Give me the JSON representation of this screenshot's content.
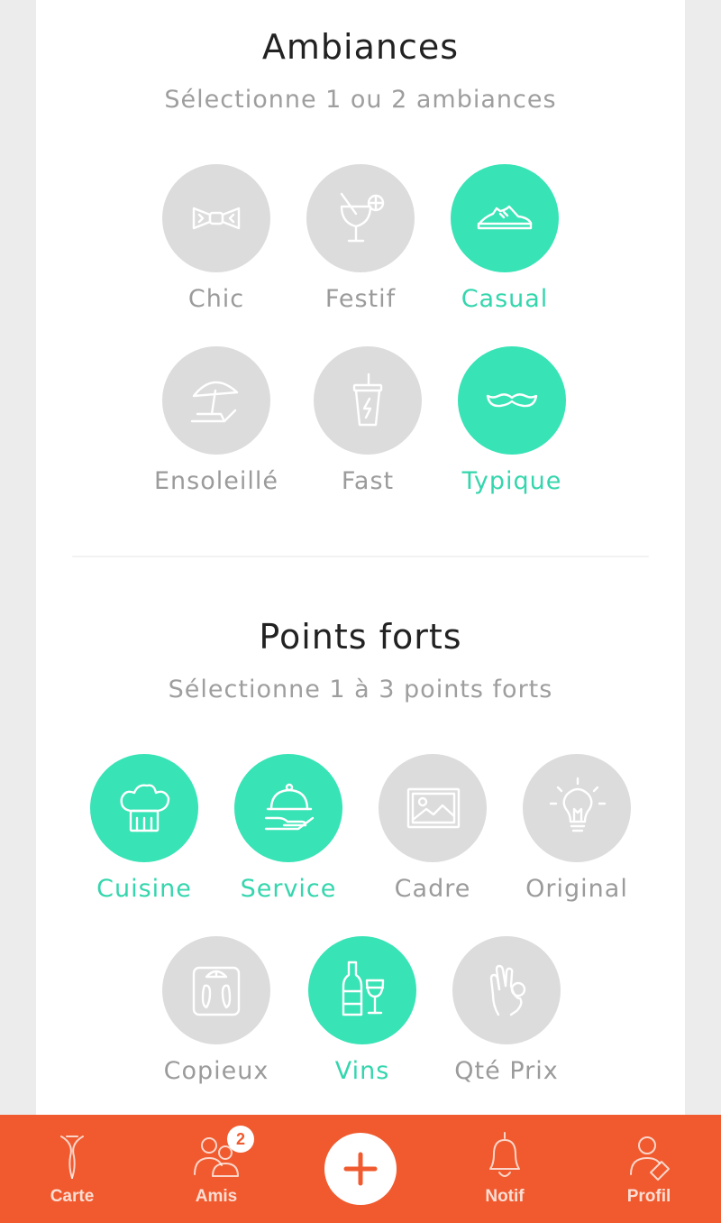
{
  "ambiances": {
    "title": "Ambiances",
    "subtitle": "Sélectionne 1 ou 2 ambiances",
    "options": [
      {
        "label": "Chic",
        "icon": "bow-tie-icon",
        "selected": false
      },
      {
        "label": "Festif",
        "icon": "cocktail-icon",
        "selected": false
      },
      {
        "label": "Casual",
        "icon": "sneaker-icon",
        "selected": true
      },
      {
        "label": "Ensoleillé",
        "icon": "beach-umbrella-icon",
        "selected": false
      },
      {
        "label": "Fast",
        "icon": "takeaway-cup-icon",
        "selected": false
      },
      {
        "label": "Typique",
        "icon": "mustache-icon",
        "selected": true
      }
    ]
  },
  "points_forts": {
    "title": "Points forts",
    "subtitle": "Sélectionne 1 à 3 points forts",
    "options": [
      {
        "label": "Cuisine",
        "icon": "chef-hat-icon",
        "selected": true
      },
      {
        "label": "Service",
        "icon": "cloche-icon",
        "selected": true
      },
      {
        "label": "Cadre",
        "icon": "picture-icon",
        "selected": false
      },
      {
        "label": "Original",
        "icon": "lightbulb-icon",
        "selected": false
      },
      {
        "label": "Copieux",
        "icon": "scale-icon",
        "selected": false
      },
      {
        "label": "Vins",
        "icon": "wine-icon",
        "selected": true
      },
      {
        "label": "Qté Prix",
        "icon": "ok-hand-icon",
        "selected": false
      }
    ]
  },
  "nav": {
    "accent_color": "#f05a2e",
    "items": [
      {
        "label": "Carte",
        "icon": "pin-icon"
      },
      {
        "label": "Amis",
        "icon": "friends-icon",
        "badge": "2"
      },
      {
        "label": "",
        "icon": "plus-icon"
      },
      {
        "label": "Notif",
        "icon": "bell-icon"
      },
      {
        "label": "Profil",
        "icon": "profile-icon"
      }
    ]
  },
  "colors": {
    "selected": "#38e3b6",
    "unselected": "#dcdcdc"
  }
}
